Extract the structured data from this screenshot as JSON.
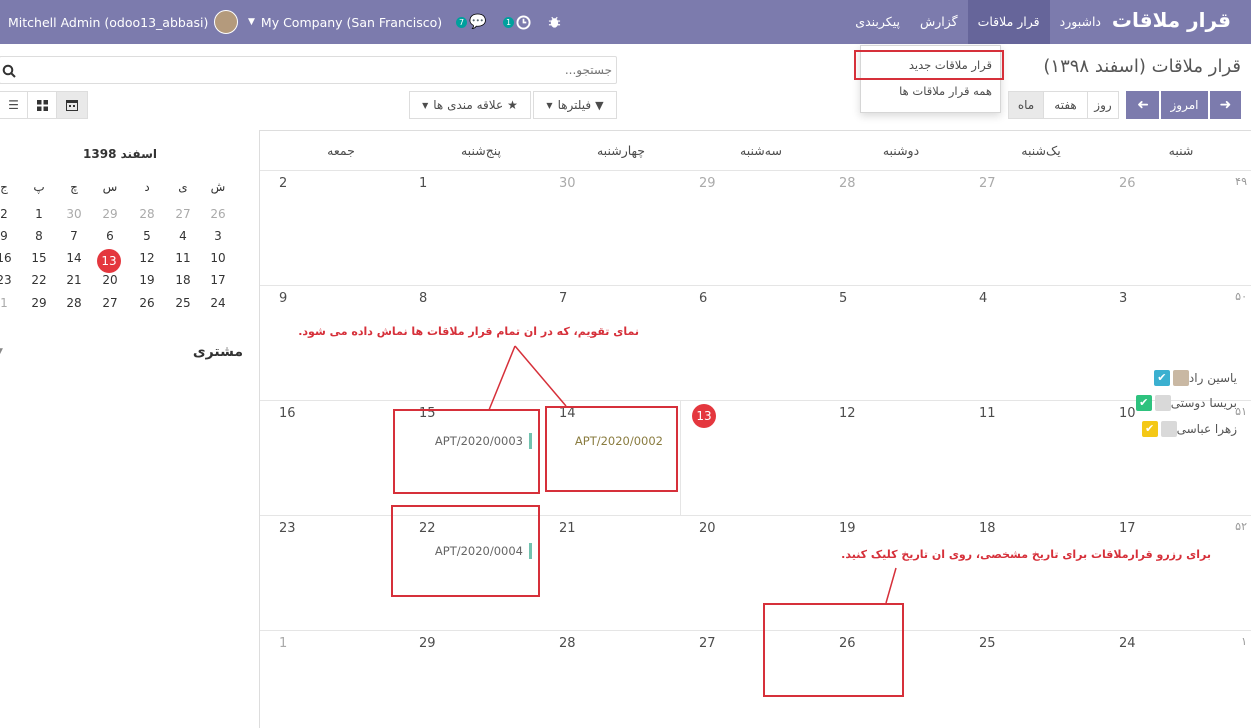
{
  "nav": {
    "brand": "قرار ملاقات",
    "menu": [
      "داشبورد",
      "قرار ملاقات",
      "گزارش",
      "پیکربندی"
    ],
    "active_index": 1,
    "company": "My Company (San Francisco)",
    "user": "Mitchell Admin (odoo13_abbasi)",
    "chat_count": "7",
    "activity_count": "1",
    "icons": [
      "chat-icon",
      "clock-icon",
      "bug-icon",
      "caret-down-icon"
    ]
  },
  "dropdown": {
    "items": [
      "قرار ملاقات جدید",
      "همه قرار ملاقات ها"
    ]
  },
  "control": {
    "title": "قرار ملاقات (اسفند ۱۳۹۸)",
    "search_placeholder": "جستجو...",
    "filters": "فیلترها",
    "favorites": "علاقه مندی ها",
    "today": "امروز",
    "views": [
      "روز",
      "هفته",
      "ماه"
    ],
    "active_view": "ماه"
  },
  "calendar": {
    "headers": [
      "شنبه",
      "یک‌شنبه",
      "دوشنبه",
      "سه‌شنبه",
      "چهارشنبه",
      "پنج‌شنبه",
      "جمعه"
    ],
    "weeks": [
      {
        "no": "۴۹",
        "days": [
          "26",
          "27",
          "28",
          "29",
          "30",
          "1",
          "2"
        ],
        "muted": [
          true,
          true,
          true,
          true,
          true,
          false,
          false
        ]
      },
      {
        "no": "۵۰",
        "days": [
          "3",
          "4",
          "5",
          "6",
          "7",
          "8",
          "9"
        ],
        "muted": [
          false,
          false,
          false,
          false,
          false,
          false,
          false
        ]
      },
      {
        "no": "۵۱",
        "days": [
          "10",
          "11",
          "12",
          "13",
          "14",
          "15",
          "16"
        ],
        "muted": [
          false,
          false,
          false,
          false,
          false,
          false,
          false
        ]
      },
      {
        "no": "۵۲",
        "days": [
          "17",
          "18",
          "19",
          "20",
          "21",
          "22",
          "23"
        ],
        "muted": [
          false,
          false,
          false,
          false,
          false,
          false,
          false
        ]
      },
      {
        "no": "۱",
        "days": [
          "24",
          "25",
          "26",
          "27",
          "28",
          "29",
          "1"
        ],
        "muted": [
          false,
          false,
          false,
          false,
          false,
          false,
          true
        ]
      }
    ],
    "events": [
      "APT/2020/0002",
      "APT/2020/0003",
      "APT/2020/0004"
    ],
    "annotation_1": "نمای تقویم، که در ان تمام قرار ملاقات ها نماش داده می شود.",
    "annotation_2": "برای رزرو قرارملاقات برای تاریخ مشخصی، روی ان تاریخ کلیک کنید."
  },
  "minical": {
    "title": "اسفند 1398",
    "dow": [
      "ش",
      "ی",
      "د",
      "س",
      "چ",
      "پ",
      "ج"
    ],
    "rows": [
      [
        "26",
        "27",
        "28",
        "29",
        "30",
        "1",
        "2"
      ],
      [
        "3",
        "4",
        "5",
        "6",
        "7",
        "8",
        "9"
      ],
      [
        "10",
        "11",
        "12",
        "13",
        "14",
        "15",
        "16"
      ],
      [
        "17",
        "18",
        "19",
        "20",
        "21",
        "22",
        "23"
      ],
      [
        "24",
        "25",
        "26",
        "27",
        "28",
        "29",
        "1"
      ]
    ]
  },
  "attendees": {
    "title": "مشتری",
    "items": [
      "یاسین راد",
      "بریسا دوستی",
      "زهرا عباسی"
    ],
    "colors": [
      "#3bb0d0",
      "#2ec27e",
      "#f4c816"
    ]
  }
}
